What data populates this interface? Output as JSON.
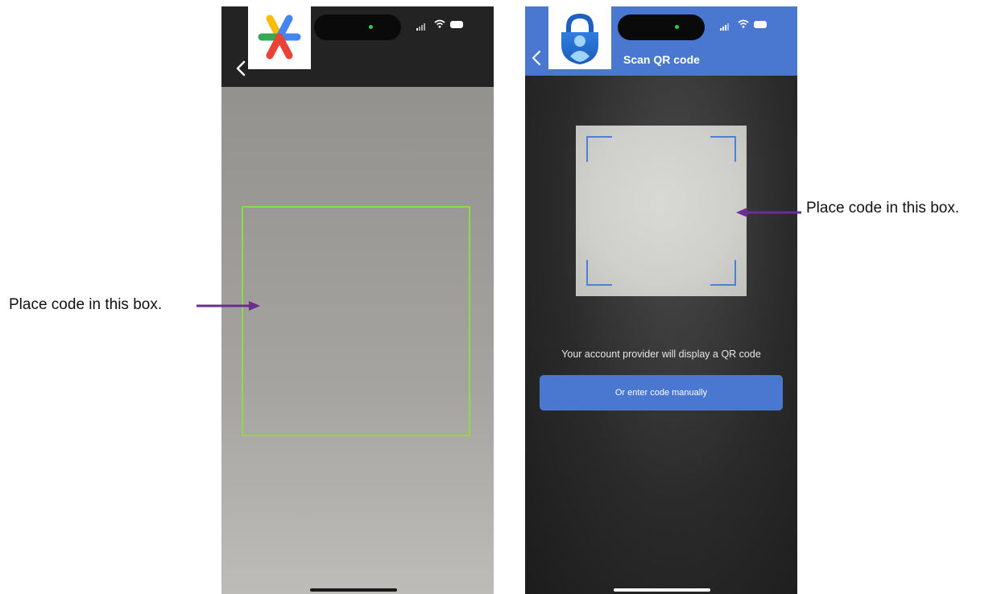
{
  "colors": {
    "scan_frame": "#8bdc4a",
    "ms_header": "#4a78d0",
    "arrow": "#6b2d91",
    "bracket": "#4f7fd8"
  },
  "left_phone": {
    "app_icon": "google-authenticator-logo",
    "back_icon": "chevron-left-icon"
  },
  "right_phone": {
    "app_icon": "microsoft-authenticator-logo",
    "back_icon": "chevron-left-icon",
    "title": "Scan QR code",
    "prompt": "Your account provider will display a QR code",
    "manual_button": "Or enter code manually"
  },
  "callouts": {
    "left": "Place code in this box.",
    "right": "Place code in this box."
  }
}
